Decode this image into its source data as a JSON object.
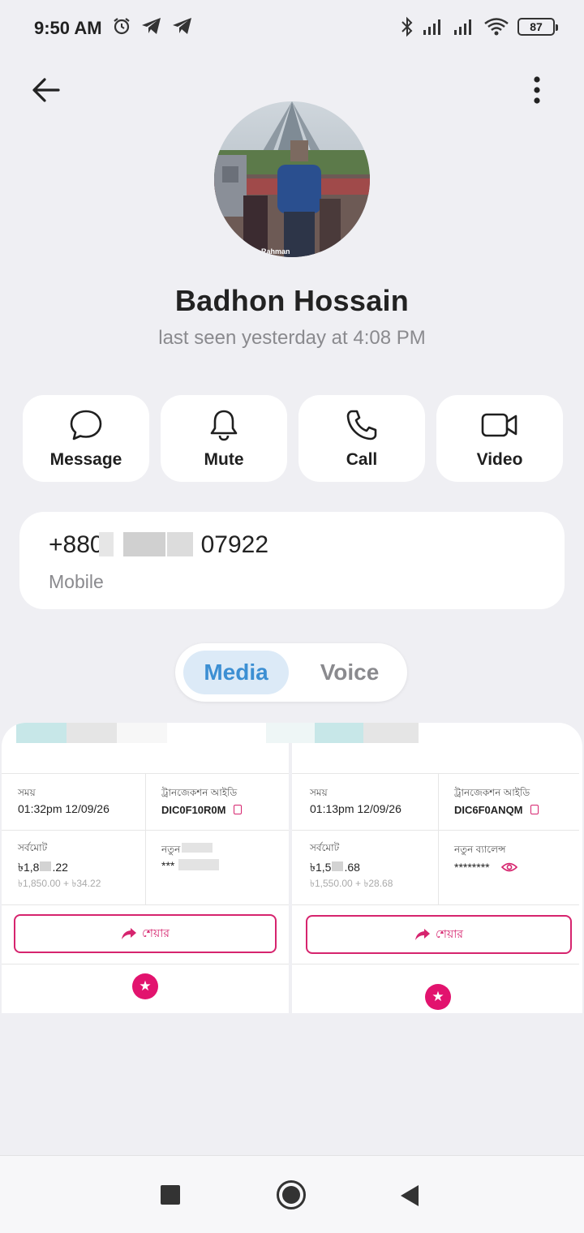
{
  "status_bar": {
    "time": "9:50 AM",
    "left_icons": [
      "alarm-icon",
      "telegram-icon",
      "telegram-icon"
    ],
    "right_icons": [
      "bluetooth-icon",
      "signal-icon",
      "signal-icon",
      "wifi-icon"
    ],
    "battery": "87"
  },
  "header": {
    "back_icon": "arrow-left-icon",
    "menu_icon": "more-vertical-icon"
  },
  "profile": {
    "name": "Badhon Hossain",
    "status": "last seen yesterday at 4:08 PM",
    "avatar_caption": "Rahman"
  },
  "actions": [
    {
      "label": "Message",
      "icon": "message-icon"
    },
    {
      "label": "Mute",
      "icon": "bell-icon"
    },
    {
      "label": "Call",
      "icon": "phone-icon"
    },
    {
      "label": "Video",
      "icon": "video-icon"
    }
  ],
  "phone": {
    "number_start": "+880",
    "number_end": "07922",
    "type": "Mobile"
  },
  "tabs": {
    "media": "Media",
    "voice": "Voice",
    "active": "Media"
  },
  "media_items": [
    {
      "time_label": "সময়",
      "time_value": "01:32pm 12/09/26",
      "txid_label": "ট্রানজেকশন আইডি",
      "txid_value": "DIC0F10R0M",
      "total_label": "সর্বমোট",
      "total_value_start": "৳1,8",
      "total_value_end": ".22",
      "total_breakdown": "৳1,850.00 + ৳34.22",
      "balance_label": "নতুন",
      "balance_value": "***",
      "share_label": "শেয়ার"
    },
    {
      "time_label": "সময়",
      "time_value": "01:13pm 12/09/26",
      "txid_label": "ট্রানজেকশন আইডি",
      "txid_value": "DIC6F0ANQM",
      "total_label": "সর্বমোট",
      "total_value_start": "৳1,5",
      "total_value_end": ".68",
      "total_breakdown": "৳1,550.00 + ৳28.68",
      "balance_label": "নতুন ব্যালেন্স",
      "balance_value": "********",
      "share_label": "শেয়ার"
    }
  ],
  "colors": {
    "accent_blue": "#3c8fd3",
    "bkash_pink": "#e2136e",
    "background": "#efeff3"
  },
  "nav_bar": [
    "recents-icon",
    "home-icon",
    "back-icon"
  ]
}
